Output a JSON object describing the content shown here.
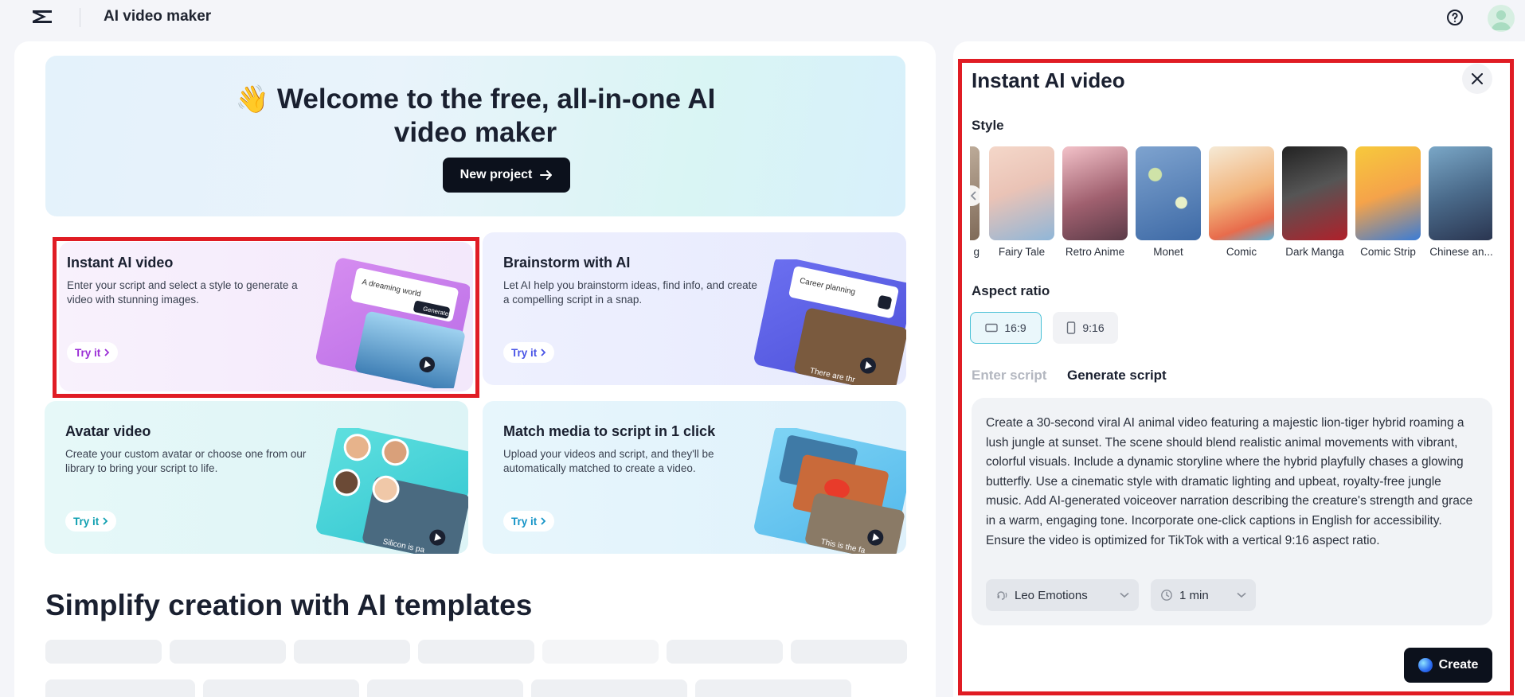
{
  "topbar": {
    "title": "AI video maker"
  },
  "hero": {
    "emoji": "👋",
    "title_line1": "Welcome to the free, all-in-one AI",
    "title_line2": "video maker",
    "new_project_label": "New project"
  },
  "cards": [
    {
      "title": "Instant AI video",
      "desc": "Enter your script and select a style to generate a video with stunning images.",
      "cta": "Try it",
      "art_text": "A dreaming world",
      "art_button": "Generate"
    },
    {
      "title": "Brainstorm with AI",
      "desc": "Let AI help you brainstorm ideas, find info, and create a compelling script in a snap.",
      "cta": "Try it",
      "art_text": "Career planning",
      "art_caption": "There are thr"
    },
    {
      "title": "Avatar video",
      "desc": "Create your custom avatar or choose one from our library to bring your script to life.",
      "cta": "Try it",
      "art_caption": "Silicon is pa"
    },
    {
      "title": "Match media to script in 1 click",
      "desc": "Upload your videos and script, and they'll be automatically matched to create a video.",
      "cta": "Try it",
      "art_caption": "This is the fa"
    }
  ],
  "templates_section": {
    "title": "Simplify creation with AI templates"
  },
  "panel": {
    "title": "Instant AI video",
    "style_label": "Style",
    "styles": [
      {
        "name": "g",
        "c1": "#c9b8a6",
        "c2": "#7f6a58"
      },
      {
        "name": "Fairy Tale",
        "c1": "#f4d7c9",
        "c2": "#8fb6d8"
      },
      {
        "name": "Retro Anime",
        "c1": "#f3c2c9",
        "c2": "#5b3b48"
      },
      {
        "name": "Monet",
        "c1": "#7ea3cf",
        "c2": "#3e6aa6"
      },
      {
        "name": "Comic",
        "c1": "#f5ead6",
        "c2": "#e86c4c"
      },
      {
        "name": "Dark Manga",
        "c1": "#222222",
        "c2": "#b0202a"
      },
      {
        "name": "Comic Strip",
        "c1": "#f7c93c",
        "c2": "#3a7cd6"
      },
      {
        "name": "Chinese an...",
        "c1": "#7aa7c7",
        "c2": "#2a3550"
      }
    ],
    "aspect_label": "Aspect ratio",
    "aspect_options": [
      "16:9",
      "9:16"
    ],
    "tabs": [
      "Enter script",
      "Generate script"
    ],
    "script": "Create a 30-second viral AI animal video featuring a majestic lion-tiger hybrid roaming a lush jungle at sunset. The scene should blend realistic animal movements with vibrant, colorful visuals. Include a dynamic storyline where the hybrid playfully chases a glowing butterfly. Use a cinematic style with dramatic lighting and upbeat, royalty-free jungle music. Add AI-generated voiceover narration describing the creature's strength and grace in a warm, engaging tone. Incorporate one-click captions in English for accessibility. Ensure the video is optimized for TikTok with a vertical 9:16 aspect ratio.",
    "voice": "Leo Emotions",
    "duration": "1 min",
    "create_label": "Create"
  }
}
